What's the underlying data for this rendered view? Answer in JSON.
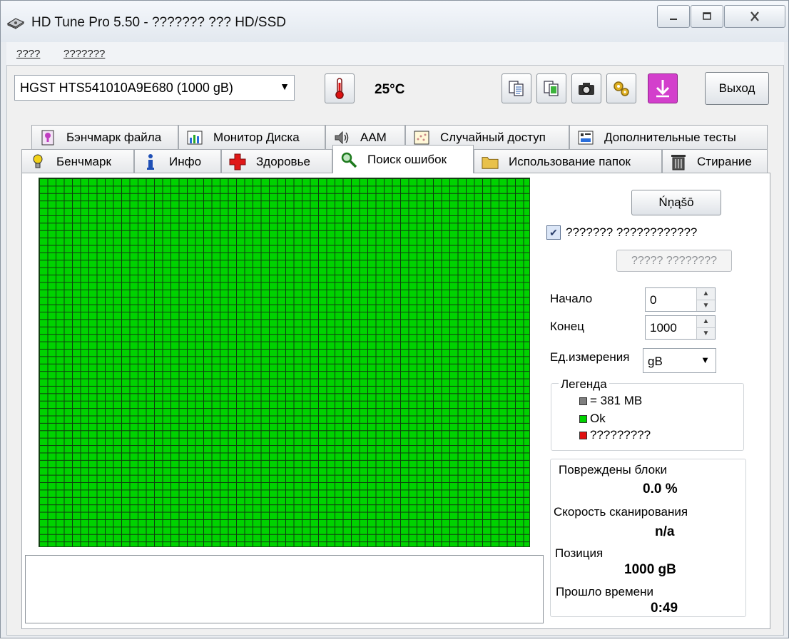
{
  "window": {
    "title": "HD Tune Pro 5.50 - ??????? ??? HD/SSD",
    "icon": "hdtune-drive-icon"
  },
  "menu": {
    "items": [
      "????",
      "???????"
    ]
  },
  "toolbar": {
    "drive": "HGST HTS541010A9E680 (1000 gB)",
    "temperature": "25°C",
    "exit_label": "Выход"
  },
  "tabs": {
    "row1": [
      {
        "label": "Бэнчмарк файла",
        "icon": "file-benchmark-icon"
      },
      {
        "label": "Монитор Диска",
        "icon": "disk-monitor-icon"
      },
      {
        "label": "AAM",
        "icon": "speaker-icon"
      },
      {
        "label": "Случайный доступ",
        "icon": "random-access-icon"
      },
      {
        "label": "Дополнительные  тесты",
        "icon": "extra-tests-icon"
      }
    ],
    "row2": [
      {
        "label": "Бенчмарк",
        "icon": "bulb-icon"
      },
      {
        "label": "Инфо",
        "icon": "info-icon"
      },
      {
        "label": "Здоровье",
        "icon": "health-cross-icon"
      },
      {
        "label": "Поиск ошибок",
        "icon": "magnifier-icon",
        "active": true
      },
      {
        "label": "Использование папок",
        "icon": "folder-icon"
      },
      {
        "label": "Стирание",
        "icon": "trash-icon"
      }
    ]
  },
  "error_scan": {
    "start_button": "Ńņąšō",
    "quick_scan_label": "??????? ????????????",
    "quick_scan_checked": true,
    "disabled_button": "????? ????????",
    "start_label": "Начало",
    "start_value": "0",
    "end_label": "Конец",
    "end_value": "1000",
    "unit_label": "Ед.измерения",
    "unit_value": "gB",
    "legend": {
      "title": "Легенда",
      "items": [
        {
          "label": "= 381 MB",
          "color": "#7f7f7f"
        },
        {
          "label": "Ok",
          "color": "#00d200"
        },
        {
          "label": "?????????",
          "color": "#e01010"
        }
      ]
    },
    "stats": {
      "damaged_label": "Повреждены блоки",
      "damaged_value": "0.0 %",
      "speed_label": "Скорость сканирования",
      "speed_value": "n/a",
      "position_label": "Позиция",
      "position_value": "1000 gB",
      "elapsed_label": "Прошло времени",
      "elapsed_value": "0:49"
    },
    "block_map": {
      "status": "Ok",
      "color": "#00d200",
      "columns": 60,
      "rows": 50
    }
  }
}
